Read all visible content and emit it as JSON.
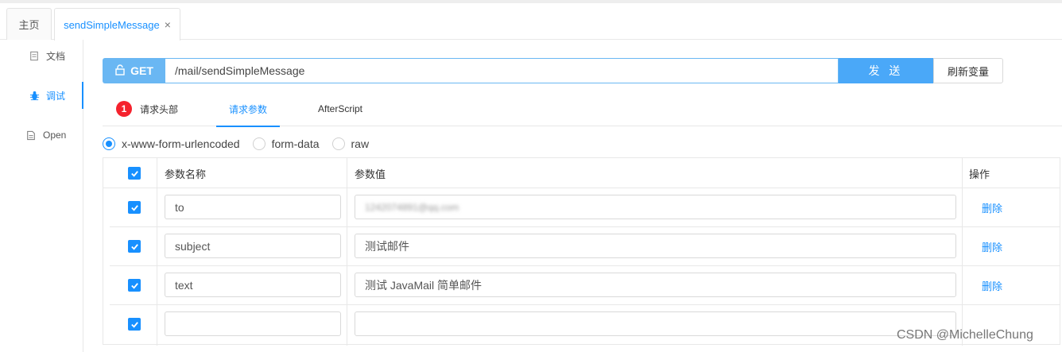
{
  "tabs": {
    "home_label": "主页",
    "active_label": "sendSimpleMessage",
    "close_glyph": "×"
  },
  "sidebar": {
    "items": [
      {
        "label": "文档",
        "icon": "document-icon"
      },
      {
        "label": "调试",
        "icon": "bug-icon"
      },
      {
        "label": "Open",
        "icon": "file-icon"
      }
    ]
  },
  "request": {
    "method": "GET",
    "url": "/mail/sendSimpleMessage",
    "send_label": "发 送",
    "refresh_label": "刷新变量"
  },
  "subtabs": {
    "headers_label": "请求头部",
    "headers_badge": "1",
    "params_label": "请求参数",
    "after_label": "AfterScript"
  },
  "body_types": {
    "options": [
      "x-www-form-urlencoded",
      "form-data",
      "raw"
    ],
    "selected": "x-www-form-urlencoded"
  },
  "params_table": {
    "headers": {
      "name": "参数名称",
      "value": "参数值",
      "action": "操作"
    },
    "rows": [
      {
        "name": "to",
        "value": "1242074891@qq.com",
        "action": "删除"
      },
      {
        "name": "subject",
        "value": "测试邮件",
        "action": "删除"
      },
      {
        "name": "text",
        "value": "测试 JavaMail 简单邮件",
        "action": "删除"
      },
      {
        "name": "",
        "value": "",
        "action": ""
      }
    ]
  },
  "watermark": "CSDN @MichelleChung",
  "colors": {
    "accent": "#1890ff",
    "method_bg": "#6ab7f3",
    "send_bg": "#4aa8f8",
    "badge": "#f5222d"
  }
}
